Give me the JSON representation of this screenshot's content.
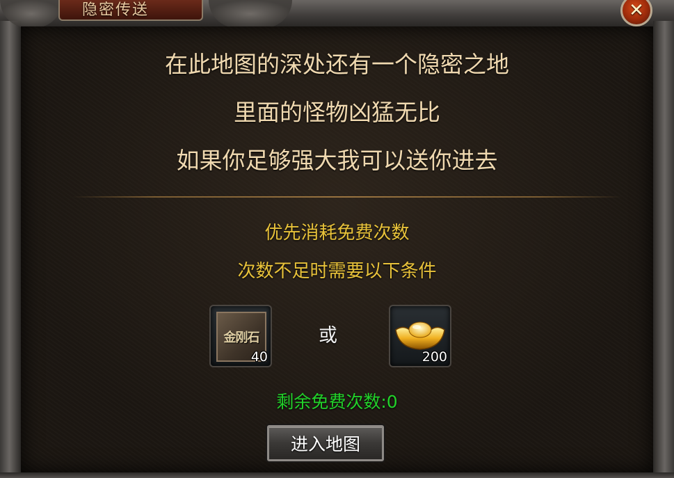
{
  "window": {
    "title": "隐密传送",
    "close_icon": "close-icon"
  },
  "intro": {
    "line1": "在此地图的深处还有一个隐密之地",
    "line2": "里面的怪物凶猛无比",
    "line3": "如果你足够强大我可以送你进去"
  },
  "conditions": {
    "line1": "优先消耗免费次数",
    "line2": "次数不足时需要以下条件"
  },
  "costs": {
    "item1": {
      "icon": "diamond-stone-icon",
      "label": "金刚石",
      "count": "40"
    },
    "separator": "或",
    "item2": {
      "icon": "gold-ingot-icon",
      "count": "200"
    }
  },
  "remaining": "剩余免费次数:0",
  "enter_button": "进入地图",
  "colors": {
    "intro_text": "#f0d9b0",
    "condition_text": "#e8c23a",
    "remaining_text": "#22d12a",
    "title_tab": "#6b2a1a"
  }
}
